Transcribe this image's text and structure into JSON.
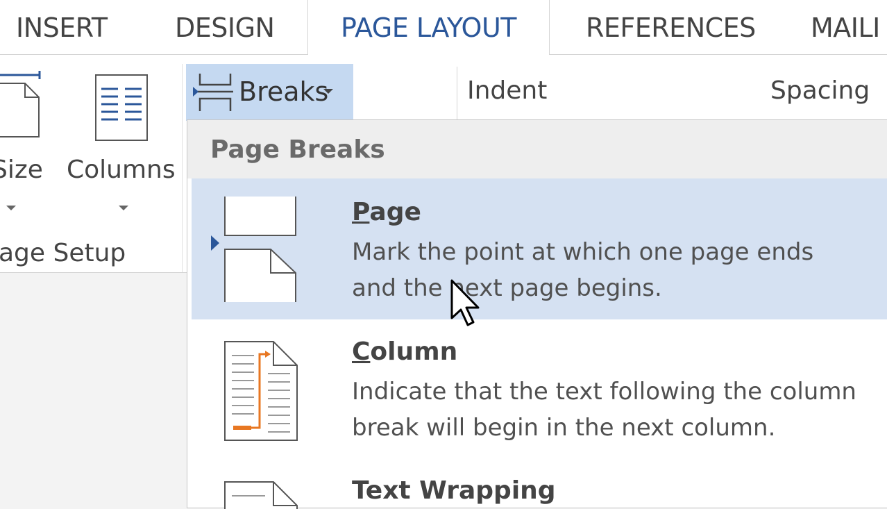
{
  "tabs": [
    {
      "label": "INSERT",
      "active": false
    },
    {
      "label": "DESIGN",
      "active": false
    },
    {
      "label": "PAGE LAYOUT",
      "active": true
    },
    {
      "label": "REFERENCES",
      "active": false
    },
    {
      "label": "MAILI",
      "active": false
    }
  ],
  "ribbon": {
    "size_label": "Size",
    "columns_label": "Columns",
    "group_label": "age Setup",
    "breaks_label": "Breaks",
    "indent_label": "Indent",
    "spacing_label": "Spacing"
  },
  "breaks_menu": {
    "header": "Page Breaks",
    "items": [
      {
        "title_key": "P",
        "title_rest": "age",
        "desc_line1": "Mark the point at which one page ends",
        "desc_line2": "and the next page begins.",
        "icon": "page-break-icon",
        "highlighted": true
      },
      {
        "title_key": "C",
        "title_rest": "olumn",
        "desc_line1": "Indicate that the text following the column",
        "desc_line2": "break will begin in the next column.",
        "icon": "column-break-icon",
        "highlighted": false
      },
      {
        "title_key": "",
        "title_rest": "Text Wrapping",
        "desc_line1": "",
        "desc_line2": "",
        "icon": "text-wrapping-icon",
        "highlighted": false
      }
    ]
  },
  "colors": {
    "accent": "#2b579a",
    "highlight": "#d5e1f2",
    "breaks_button": "#c5d9f1",
    "column_orange": "#e87722"
  }
}
